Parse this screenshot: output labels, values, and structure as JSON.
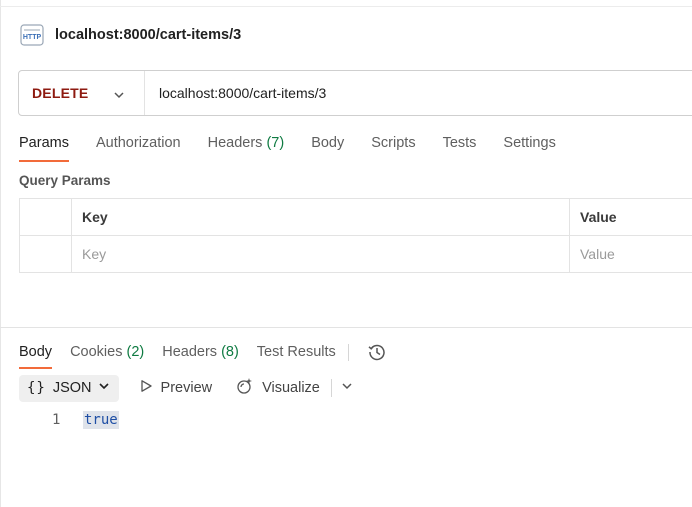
{
  "request": {
    "icon": "http-icon",
    "title": "localhost:8000/cart-items/3"
  },
  "url_bar": {
    "method": "DELETE",
    "url": "localhost:8000/cart-items/3",
    "method_color": "#8e1a10"
  },
  "request_tabs": {
    "params": "Params",
    "authorization": "Authorization",
    "headers": "Headers",
    "headers_count": "(7)",
    "body": "Body",
    "scripts": "Scripts",
    "tests": "Tests",
    "settings": "Settings"
  },
  "query_params": {
    "label": "Query Params",
    "columns": [
      "Key",
      "Value"
    ],
    "key_placeholder": "Key",
    "value_placeholder": "Value"
  },
  "response_tabs": {
    "body": "Body",
    "cookies": "Cookies",
    "cookies_count": "(2)",
    "headers": "Headers",
    "headers_count": "(8)",
    "test_results": "Test Results"
  },
  "response_view": {
    "format_icon": "{}",
    "format": "JSON",
    "preview": "Preview",
    "visualize": "Visualize"
  },
  "response_body": {
    "lines": [
      {
        "number": "1",
        "text": "true"
      }
    ]
  },
  "colors": {
    "accent": "#f26b3a",
    "count_green": "#0f7b42",
    "boolean_blue": "#1f4fa5"
  }
}
